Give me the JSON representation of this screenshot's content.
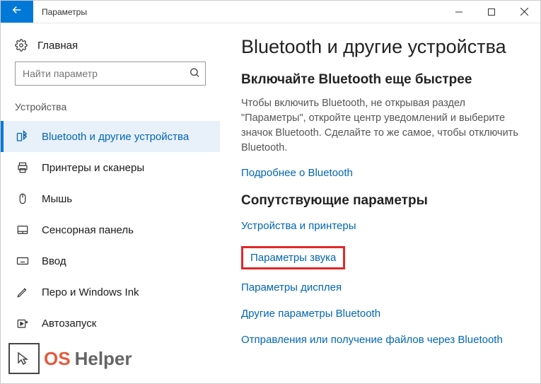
{
  "titlebar": {
    "title": "Параметры"
  },
  "sidebar": {
    "home": "Главная",
    "search_placeholder": "Найти параметр",
    "section_label": "Устройства",
    "items": [
      {
        "label": "Bluetooth и другие устройства",
        "icon": "bluetooth",
        "active": true
      },
      {
        "label": "Принтеры и сканеры",
        "icon": "printer",
        "active": false
      },
      {
        "label": "Мышь",
        "icon": "mouse",
        "active": false
      },
      {
        "label": "Сенсорная панель",
        "icon": "touchpad",
        "active": false
      },
      {
        "label": "Ввод",
        "icon": "keyboard",
        "active": false
      },
      {
        "label": "Перо и Windows Ink",
        "icon": "pen",
        "active": false
      },
      {
        "label": "Автозапуск",
        "icon": "autoplay",
        "active": false
      }
    ]
  },
  "main": {
    "heading": "Bluetooth и другие устройства",
    "sub_heading": "Включайте Bluetooth еще быстрее",
    "description": "Чтобы включить Bluetooth, не открывая раздел \"Параметры\", откройте центр уведомлений и выберите значок Bluetooth. Сделайте то же самое, чтобы отключить Bluetooth.",
    "learn_more": "Подробнее о Bluetooth",
    "related_heading": "Сопутствующие параметры",
    "related_links": [
      "Устройства и принтеры",
      "Параметры звука",
      "Параметры дисплея",
      "Другие параметры Bluetooth",
      "Отправления или получение файлов через Bluetooth"
    ],
    "highlighted_link_index": 1
  },
  "watermark": {
    "part1": "OS",
    "part2": "Helper"
  }
}
